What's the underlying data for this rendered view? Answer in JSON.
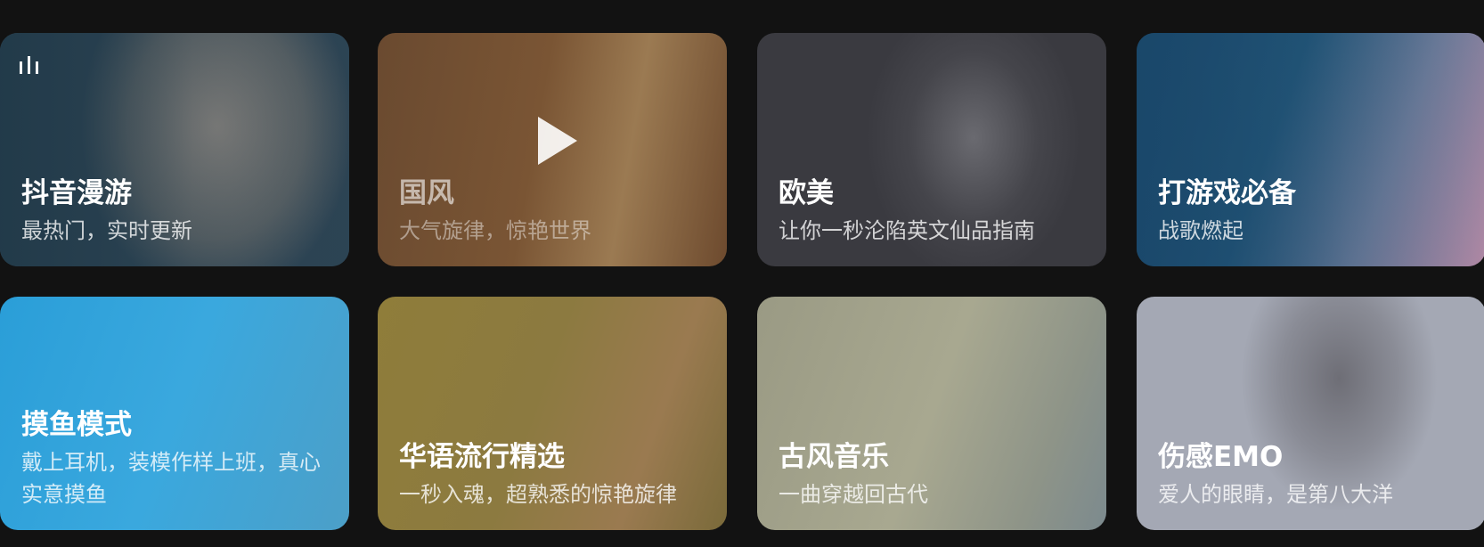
{
  "cards": [
    {
      "title": "抖音漫游",
      "subtitle": "最热门，实时更新",
      "icon": "equalizer-icon"
    },
    {
      "title": "国风",
      "subtitle": "大气旋律，惊艳世界",
      "icon": "play-icon"
    },
    {
      "title": "欧美",
      "subtitle": "让你一秒沦陷英文仙品指南"
    },
    {
      "title": "打游戏必备",
      "subtitle": "战歌燃起"
    },
    {
      "title": "摸鱼模式",
      "subtitle": "戴上耳机，装模作样上班，真心实意摸鱼"
    },
    {
      "title": "华语流行精选",
      "subtitle": "一秒入魂，超熟悉的惊艳旋律"
    },
    {
      "title": "古风音乐",
      "subtitle": "一曲穿越回古代"
    },
    {
      "title": "伤感EMO",
      "subtitle": "爱人的眼睛，是第八大洋"
    }
  ]
}
